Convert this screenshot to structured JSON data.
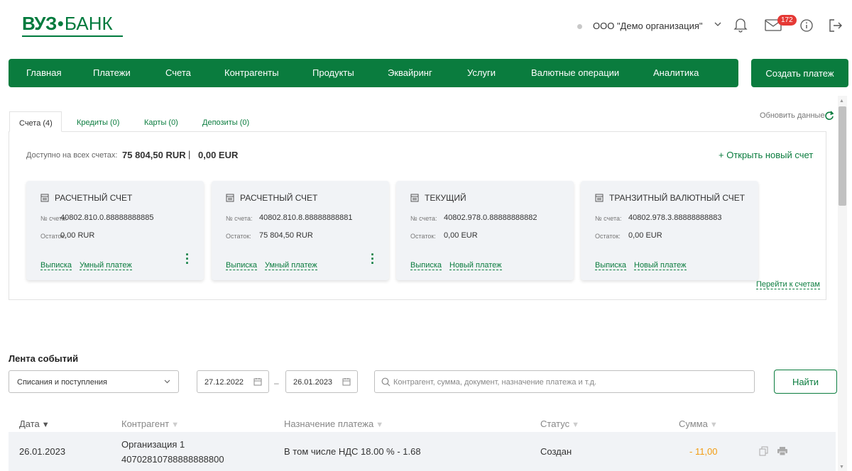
{
  "header": {
    "logo_part1": "ВУЗ",
    "logo_dot": "•",
    "logo_part2": "БАНК",
    "organization": "ООО \"Демо организация\"",
    "mail_count": "172"
  },
  "nav": {
    "items": [
      "Главная",
      "Платежи",
      "Счета",
      "Контрагенты",
      "Продукты",
      "Эквайринг",
      "Услуги",
      "Валютные операции",
      "Аналитика"
    ],
    "create_payment": "Создать платеж"
  },
  "accounts": {
    "tabs": [
      "Счета (4)",
      "Кредиты (0)",
      "Карты (0)",
      "Депозиты (0)"
    ],
    "refresh_label": "Обновить данные",
    "available_label": "Доступно на всех счетах:",
    "available_rur": "75 804,50 RUR",
    "separator": "|",
    "available_eur": "0,00 EUR",
    "open_new": "+ Открыть новый счет",
    "account_no_label": "№ счета:",
    "balance_label": "Остаток:",
    "cards": [
      {
        "title": "Расчетный счет",
        "number": "40802.810.0.88888888885",
        "balance": "0,00 RUR",
        "link1": "Выписка",
        "link2": "Умный платеж",
        "has_menu": true
      },
      {
        "title": "Расчетный счет",
        "number": "40802.810.8.88888888881",
        "balance": "75 804,50 RUR",
        "link1": "Выписка",
        "link2": "Умный платеж",
        "has_menu": true
      },
      {
        "title": "Текущий",
        "number": "40802.978.0.88888888882",
        "balance": "0,00 EUR",
        "link1": "Выписка",
        "link2": "Новый платеж",
        "has_menu": false
      },
      {
        "title": "Транзитный валютный счет",
        "number": "40802.978.3.88888888883",
        "balance": "0,00 EUR",
        "link1": "Выписка",
        "link2": "Новый платеж",
        "has_menu": false
      }
    ],
    "go_to_accounts": "Перейти к счетам"
  },
  "feed": {
    "title": "Лента событий",
    "filter_value": "Списания и поступления",
    "date_from": "27.12.2022",
    "date_sep": "–",
    "date_to": "26.01.2023",
    "search_placeholder": "Контрагент, сумма, документ, назначение платежа и т.д.",
    "find_button": "Найти",
    "columns": [
      "Дата",
      "Контрагент",
      "Назначение платежа",
      "Статус",
      "Сумма"
    ],
    "rows": [
      {
        "date": "26.01.2023",
        "counterparty": "Организация 1",
        "account": "40702810788888888800",
        "purpose": "В том числе НДС 18.00 % - 1.68",
        "status": "Создан",
        "amount": "- 11,00"
      }
    ]
  },
  "colors": {
    "brand": "#0a7c3e",
    "amount_negative": "#f39c12",
    "badge": "#e53935"
  }
}
